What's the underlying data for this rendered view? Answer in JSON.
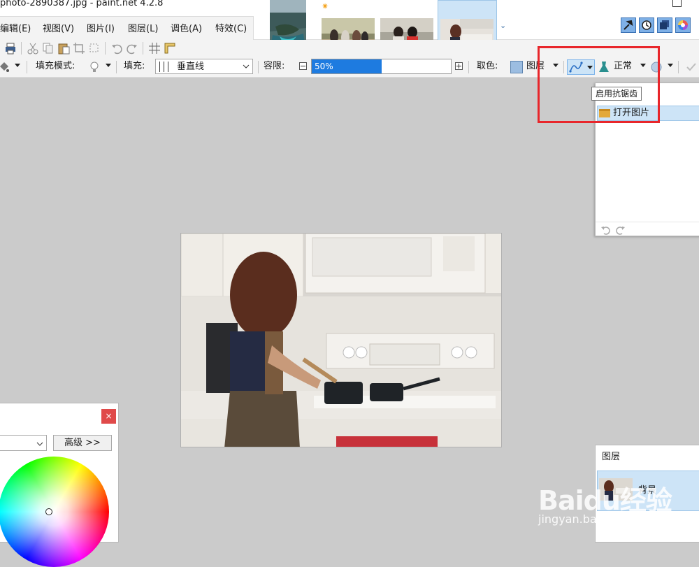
{
  "window": {
    "title": "photo-2890387.jpg - paint.net 4.2.8"
  },
  "menu": {
    "items": [
      {
        "label": "编辑(E)"
      },
      {
        "label": "视图(V)"
      },
      {
        "label": "图片(I)"
      },
      {
        "label": "图层(L)"
      },
      {
        "label": "调色(A)"
      },
      {
        "label": "特效(C)"
      }
    ]
  },
  "image_tabs": {
    "selected_index": 3,
    "tabs": [
      {
        "thumbnail": "aerial-island-photo"
      },
      {
        "thumbnail": "friends-on-path-photo"
      },
      {
        "thumbnail": "people-on-bench-photo"
      },
      {
        "thumbnail": "woman-cooking-photo"
      }
    ],
    "scroll_icon": "chevron-down-icon"
  },
  "tool_windows": [
    {
      "icon": "tools-icon"
    },
    {
      "icon": "history-icon"
    },
    {
      "icon": "layers-icon"
    },
    {
      "icon": "colors-icon"
    }
  ],
  "tool_options": {
    "fill_mode_label": "填充模式:",
    "fill_label": "填充:",
    "fill_value": "垂直线",
    "tolerance_label": "容限:",
    "tolerance_value": "50%",
    "tolerance_fraction": 0.5,
    "sampling_label": "取色:",
    "sampling_value": "图层",
    "blend_value": "正常"
  },
  "tooltip": {
    "text": "启用抗锯齿"
  },
  "history": {
    "items": [
      {
        "label": "打开图片"
      }
    ]
  },
  "layers": {
    "title": "图层",
    "items": [
      {
        "name": "背景"
      }
    ]
  },
  "colors": {
    "close_label": "×",
    "advanced_label": "高级 >>"
  },
  "colors_meta": {
    "highlight": "#e8262b",
    "selection": "#cde4f7",
    "tolerance_fill": "#1e7be0"
  },
  "watermark": {
    "logo": "Baidu经验",
    "url": "jingyan.baidu.com"
  }
}
